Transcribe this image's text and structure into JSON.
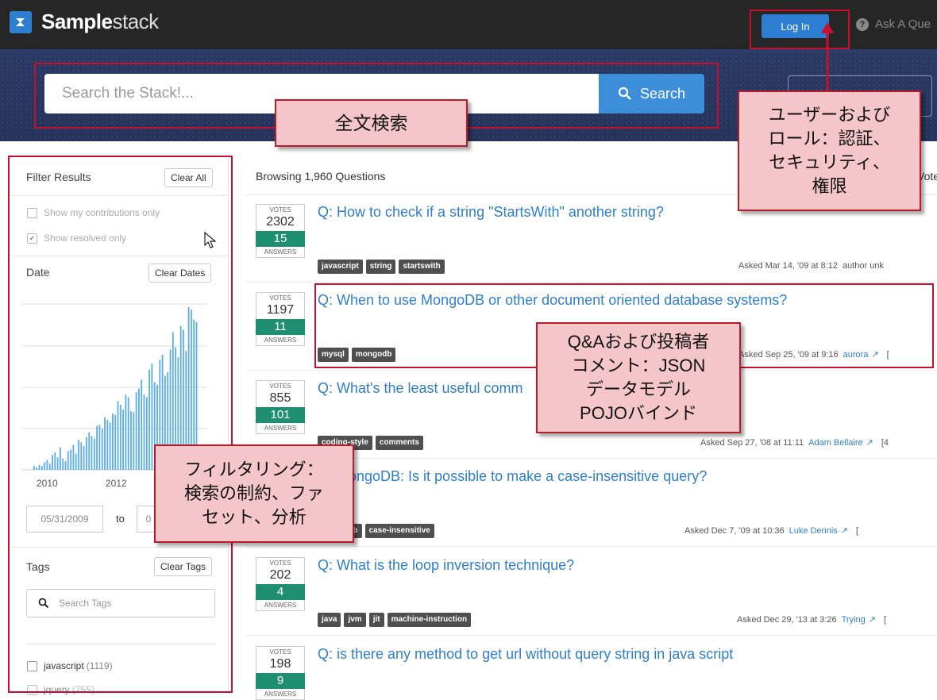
{
  "header": {
    "logo_bold": "Sample",
    "logo_light": "stack",
    "login_label": "Log In",
    "ask_label": "Ask A Que"
  },
  "search": {
    "placeholder": "Search the Stack!...",
    "button_label": "Search"
  },
  "sidebar": {
    "filter_title": "Filter Results",
    "clear_all": "Clear All",
    "show_my_contrib": "Show my contributions only",
    "show_resolved": "Show resolved only",
    "date_title": "Date",
    "clear_dates": "Clear Dates",
    "x_ticks": [
      "2010",
      "2012"
    ],
    "date_from": "05/31/2009",
    "date_to_label": "to",
    "date_to": "0",
    "tags_title": "Tags",
    "clear_tags": "Clear Tags",
    "search_tags_placeholder": "Search Tags",
    "tag_list": [
      {
        "name": "javascript",
        "count": "(1119)"
      },
      {
        "name": "jquery",
        "count": "(755)"
      }
    ]
  },
  "chart_data": {
    "type": "bar",
    "title": "",
    "xlabel": "",
    "ylabel": "",
    "x_tick_labels": [
      "2010",
      "2012"
    ],
    "values": [
      3,
      2,
      4,
      3,
      6,
      8,
      5,
      12,
      14,
      10,
      18,
      9,
      7,
      15,
      16,
      20,
      13,
      24,
      22,
      19,
      26,
      30,
      27,
      25,
      35,
      36,
      33,
      42,
      40,
      38,
      45,
      44,
      55,
      52,
      48,
      60,
      58,
      47,
      46,
      62,
      65,
      72,
      60,
      58,
      80,
      85,
      70,
      68,
      88,
      92,
      75,
      78,
      96,
      110,
      98,
      90,
      115,
      112,
      95,
      130,
      128,
      120,
      118
    ]
  },
  "main": {
    "browsing_label": "Browsing 1,960 Questions",
    "sort_hint": "Vote",
    "questions": [
      {
        "votes_label": "VOTES",
        "votes": "2302",
        "answers": "15",
        "answers_label": "ANSWERS",
        "title": "Q: How to check if a string \"StartsWith\" another string?",
        "tags": [
          "javascript",
          "string",
          "startswith"
        ],
        "asked": "Asked  Mar 14, '09 at 8:12",
        "author": "author unk",
        "ext": "",
        "rest": ""
      },
      {
        "votes_label": "VOTES",
        "votes": "1197",
        "answers": "11",
        "answers_label": "ANSWERS",
        "title": "Q: When to use MongoDB or other document oriented database systems?",
        "tags": [
          "mysql",
          "mongodb"
        ],
        "asked": "Asked  Sep 25, '09 at 9:16",
        "author": "aurora",
        "ext": "↗",
        "rest": "["
      },
      {
        "votes_label": "VOTES",
        "votes": "855",
        "answers": "101",
        "answers_label": "ANSWERS",
        "title": "Q: What's the least useful comm",
        "tags": [
          "coding-style",
          "comments"
        ],
        "asked": "Asked  Sep 27, '08 at 11:11",
        "author": "Adam Bellaire",
        "ext": "↗",
        "rest": "[4"
      },
      {
        "votes_label": "VOTES",
        "votes": "",
        "answers": "",
        "answers_label": "ANSWERS",
        "title": "Q: MongoDB: Is it possible to make a case-insensitive query?",
        "tags": [
          "mongodb",
          "case-insensitive"
        ],
        "asked": "Asked  Dec 7, '09 at 10:36",
        "author": "Luke Dennis",
        "ext": "↗",
        "rest": "["
      },
      {
        "votes_label": "VOTES",
        "votes": "202",
        "answers": "4",
        "answers_label": "ANSWERS",
        "title": "Q: What is the loop inversion technique?",
        "tags": [
          "java",
          "jvm",
          "jit",
          "machine-instruction"
        ],
        "asked": "Asked  Dec 29, '13 at 3:26",
        "author": "Trying",
        "ext": "↗",
        "rest": "["
      },
      {
        "votes_label": "VOTES",
        "votes": "198",
        "answers": "9",
        "answers_label": "ANSWERS",
        "title": "Q: is there any method to get url without query string in java script",
        "tags": [],
        "asked": "",
        "author": "",
        "ext": "",
        "rest": ""
      }
    ]
  },
  "annotations": {
    "fulltext": "全文検索",
    "auth": "ユーザーおよびロール：認証、セキュリティ、権限",
    "auth_lines": [
      "ユーザーおよび",
      "ロール：認証、",
      "セキュリティ、",
      "権限"
    ],
    "qa_lines": [
      "Q&Aおよび投稿者",
      "コメント：JSON",
      "データモデル",
      "POJOバインド"
    ],
    "filter_lines": [
      "フィルタリング：",
      "検索の制約、ファ",
      "セット、分析"
    ]
  }
}
